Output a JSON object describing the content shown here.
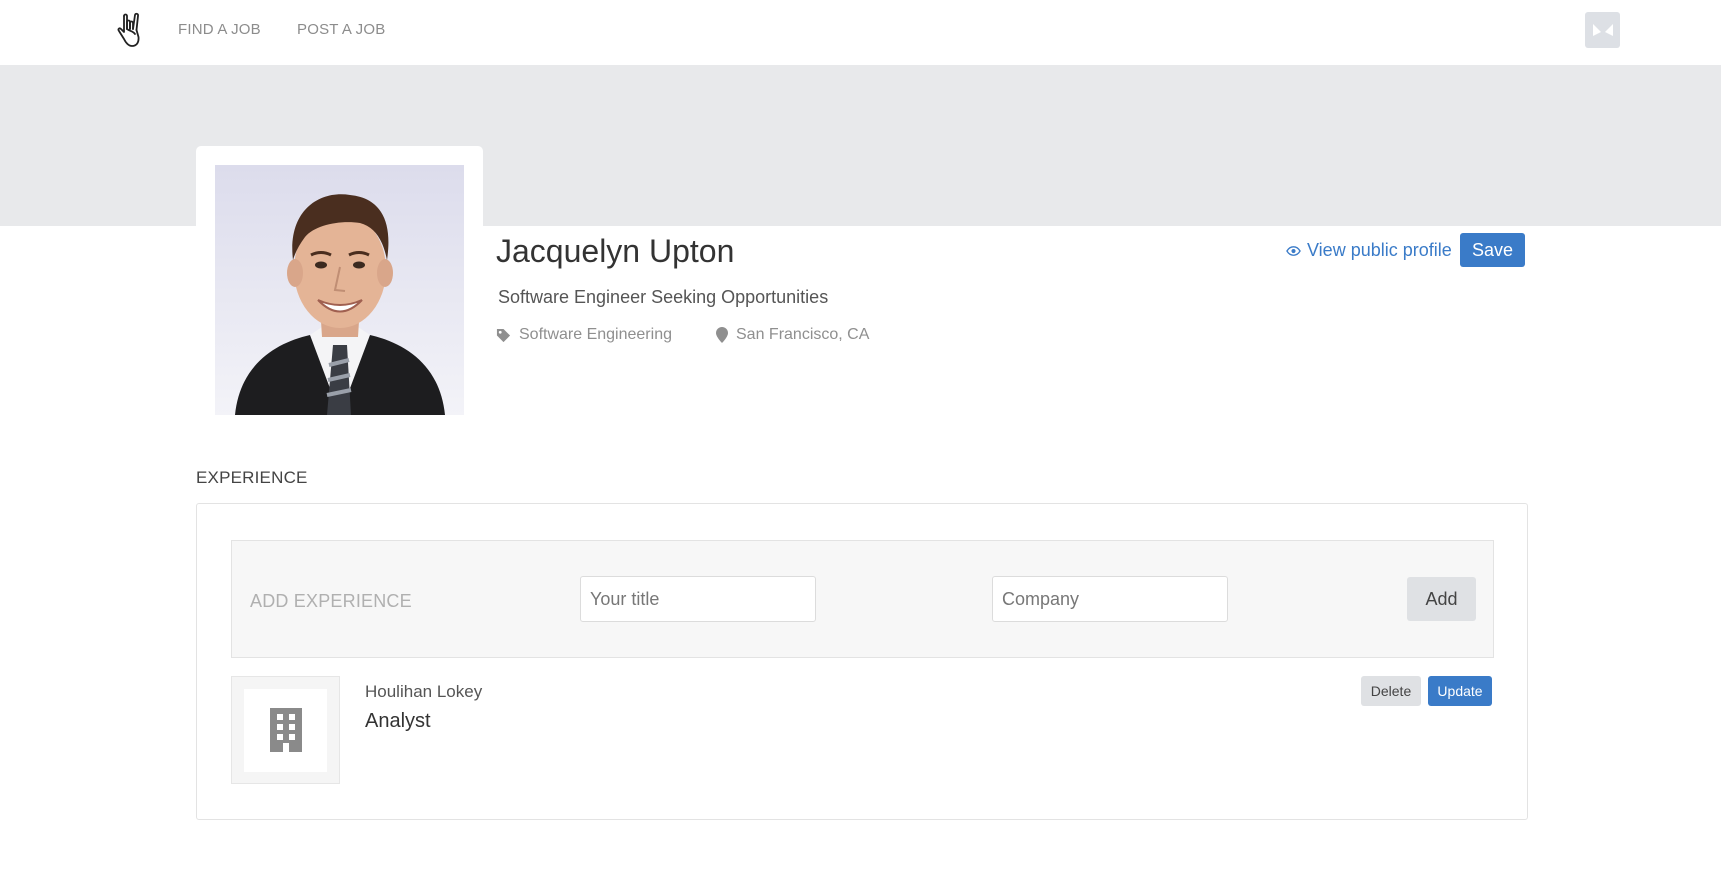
{
  "nav": {
    "logo_icon": "rock-hand-icon",
    "links": [
      {
        "label": "FIND A JOB"
      },
      {
        "label": "POST A JOB"
      }
    ],
    "avatar_icon": "user-avatar-icon"
  },
  "profile": {
    "name": "Jacquelyn Upton",
    "headline": "Software Engineer Seeking Opportunities",
    "category": "Software Engineering",
    "category_icon": "tag-icon",
    "location": "San Francisco, CA",
    "location_icon": "map-pin-icon",
    "view_public_label": "View public profile",
    "view_public_icon": "eye-icon",
    "save_label": "Save"
  },
  "experience": {
    "section_title": "EXPERIENCE",
    "add_label": "ADD EXPERIENCE",
    "title_placeholder": "Your title",
    "company_placeholder": "Company",
    "add_button": "Add",
    "items": [
      {
        "company": "Houlihan Lokey",
        "title": "Analyst",
        "logo_icon": "building-icon",
        "delete_label": "Delete",
        "update_label": "Update"
      }
    ]
  },
  "colors": {
    "accent": "#3a7bc8",
    "banner": "#e8e9eb",
    "muted_text": "#8f8f8f"
  }
}
